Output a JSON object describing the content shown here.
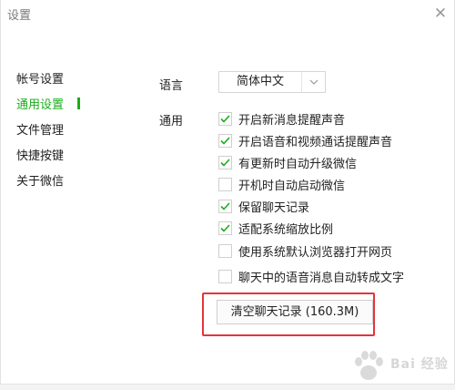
{
  "window": {
    "title": "设置",
    "close_glyph": "✕"
  },
  "sidebar": {
    "items": [
      {
        "label": "帐号设置",
        "active": false
      },
      {
        "label": "通用设置",
        "active": true
      },
      {
        "label": "文件管理",
        "active": false
      },
      {
        "label": "快捷按键",
        "active": false
      },
      {
        "label": "关于微信",
        "active": false
      }
    ]
  },
  "language": {
    "label": "语言",
    "selected": "简体中文"
  },
  "general": {
    "label": "通用",
    "options": [
      {
        "label": "开启新消息提醒声音",
        "checked": true
      },
      {
        "label": "开启语音和视频通话提醒声音",
        "checked": true
      },
      {
        "label": "有更新时自动升级微信",
        "checked": true
      },
      {
        "label": "开机时自动启动微信",
        "checked": false
      },
      {
        "label": "保留聊天记录",
        "checked": true
      },
      {
        "label": "适配系统缩放比例",
        "checked": true
      },
      {
        "label": "使用系统默认浏览器打开网页",
        "checked": false
      },
      {
        "label": "聊天中的语音消息自动转成文字",
        "checked": false
      }
    ]
  },
  "actions": {
    "clear_chat": "清空聊天记录 (160.3M)"
  },
  "watermark": {
    "text": "Bai 经验"
  },
  "colors": {
    "accent": "#1aad19",
    "highlight": "#e5343a"
  }
}
